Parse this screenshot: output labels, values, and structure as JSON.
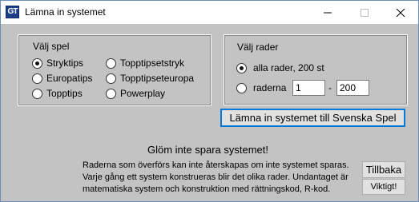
{
  "window": {
    "title": "Lämna in systemet",
    "icon_text": "GT",
    "icons": {
      "app": "app-icon",
      "minimize": "minimize-icon",
      "maximize": "maximize-icon",
      "close": "close-icon"
    }
  },
  "game_group": {
    "legend": "Välj spel",
    "options": [
      {
        "label": "Stryktips",
        "checked": true
      },
      {
        "label": "Europatips",
        "checked": false
      },
      {
        "label": "Topptips",
        "checked": false
      },
      {
        "label": "Topptipsetstryk",
        "checked": false
      },
      {
        "label": "Topptipseteuropa",
        "checked": false
      },
      {
        "label": "Powerplay",
        "checked": false
      }
    ]
  },
  "rows_group": {
    "legend": "Välj rader",
    "all_rows_label": "alla rader, 200 st",
    "all_rows_checked": true,
    "range_label": "raderna",
    "range_checked": false,
    "range_from": "1",
    "range_separator": "-",
    "range_to": "200"
  },
  "submit_button": "Lämna in systemet till Svenska Spel",
  "reminder": "Glöm inte spara systemet!",
  "info_lines": [
    "Raderna som överförs kan inte återskapas om inte systemet sparas.",
    "Varje gång ett system konstrueras blir det olika rader. Undantaget är",
    "matematiska system och konstruktion med rättningskod, R-kod."
  ],
  "back_button": "Tillbaka",
  "important_button": "Viktigt!"
}
